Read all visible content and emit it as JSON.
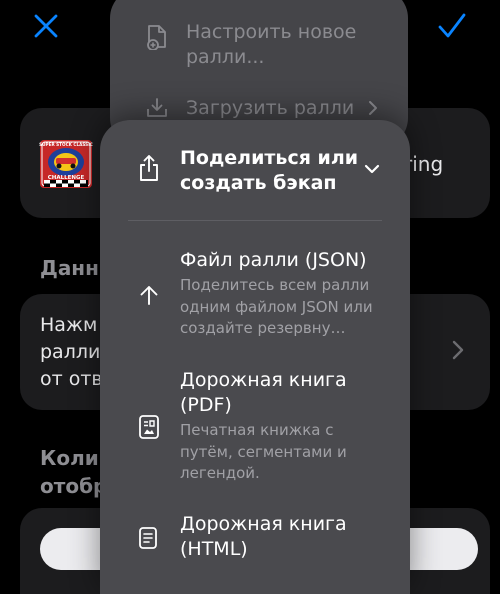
{
  "nav": {
    "close_icon": "close-icon",
    "done_icon": "checkmark-icon",
    "accent_color": "#0a84ff"
  },
  "background": {
    "rally_card": {
      "logo_icon": "super-stock-classic-challenge-logo",
      "logo_text_top": "SUPER STOCK CLASSIC",
      "logo_text_bottom": "CHALLENGE",
      "name_fragment": "ring"
    },
    "data_section_title": "Данны",
    "data_card": {
      "lines": [
        "Нажм",
        "ралли",
        "от отв"
      ],
      "chevron_icon": "chevron-right-icon"
    },
    "count_section_title_lines": [
      "Колич",
      "отобр"
    ]
  },
  "menu_back": {
    "items": [
      {
        "label": "Настроить новое ралли...",
        "icon": "new-document-icon"
      },
      {
        "label": "Загрузить ралли",
        "icon": "download-tray-icon",
        "chevron": "chevron-right-icon"
      }
    ]
  },
  "menu_front": {
    "header": {
      "title": "Поделиться или создать бэкап",
      "icon": "share-icon",
      "chevron": "chevron-down-icon"
    },
    "items": [
      {
        "title": "Файл ралли (JSON)",
        "subtitle": "Поделитесь всем ралли одним файлом JSON или создайте резервну…",
        "icon": "arrow-up-icon"
      },
      {
        "title": "Дорожная книга (PDF)",
        "subtitle": "Печатная книжка с путём, сегментами и легендой.",
        "icon": "roadbook-pdf-icon"
      },
      {
        "title": "Дорожная книга (HTML)",
        "icon": "document-text-icon"
      }
    ]
  }
}
